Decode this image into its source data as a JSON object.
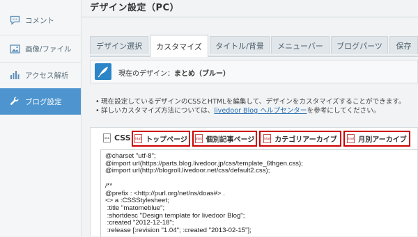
{
  "sidebar": {
    "items": [
      {
        "label": "コメント",
        "icon": "comment-icon"
      },
      {
        "label": "画像/ファイル",
        "icon": "image-icon"
      },
      {
        "label": "アクセス解析",
        "icon": "bar-chart-icon"
      },
      {
        "label": "ブログ設定",
        "icon": "wrench-icon",
        "active": true
      }
    ]
  },
  "page": {
    "title": "デザイン設定（PC）"
  },
  "tabs": [
    {
      "label": "デザイン選択"
    },
    {
      "label": "カスタマイズ",
      "active": true
    },
    {
      "label": "タイトル/背景"
    },
    {
      "label": "メニューバー"
    },
    {
      "label": "ブログパーツ"
    },
    {
      "label": "保存"
    }
  ],
  "current_design": {
    "prefix": "現在のデザイン：",
    "name": "まとめ（ブルー）"
  },
  "info": {
    "line1": "現在設定しているデザインのCSSとHTMLを編集して、デザインをカスタマイズすることができます。",
    "line2_before": "詳しいカスタマイズ方法については、",
    "line2_link": "livedoor Blog ヘルプセンター",
    "line2_after": "を参考にしてください。"
  },
  "editor": {
    "css_label": "CSS",
    "templates": [
      {
        "label": "トップページ"
      },
      {
        "label": "個別記事ページ"
      },
      {
        "label": "カテゴリアーカイブ"
      },
      {
        "label": "月別アーカイブ"
      }
    ],
    "code_lines": [
      "@charset \"utf-8\";",
      "@import url(https://parts.blog.livedoor.jp/css/template_6thgen.css);",
      "@import url(http://blogroll.livedoor.net/css/default2.css);",
      "",
      "/**",
      "@prefix : <http://purl.org/net/ns/doas#> .",
      "<> a :CSSStylesheet;",
      " :title \"matomeblue\";",
      " :shortdesc \"Design template for livedoor Blog\";",
      " :created \"2012-12-18\";",
      " :release [:revision \"1.04\"; :created \"2013-02-15\"];"
    ]
  },
  "colors": {
    "accent": "#4e95cf",
    "highlight_border": "#cc0000",
    "link": "#2b6fb0",
    "feather_tile": "#2c85c7"
  }
}
